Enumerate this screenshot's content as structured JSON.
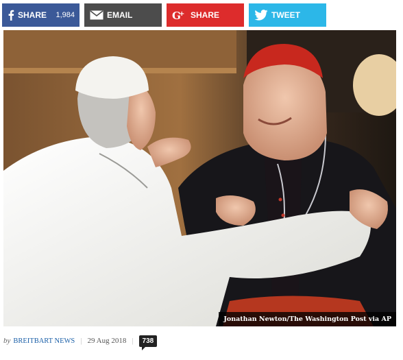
{
  "share": {
    "facebook": {
      "label": "SHARE",
      "count": "1,984",
      "icon": "facebook-icon",
      "color": "#3b5998"
    },
    "email": {
      "label": "EMAIL",
      "icon": "envelope-icon",
      "color": "#4c4c4c"
    },
    "gplus": {
      "label": "SHARE",
      "icon": "google-plus-icon",
      "color": "#dd2c2c"
    },
    "twitter": {
      "label": "TWEET",
      "icon": "twitter-bird-icon",
      "color": "#2cb7e8"
    }
  },
  "photo": {
    "credit": "Jonathan Newton/The Washington Post via AP"
  },
  "byline": {
    "by": "by",
    "author": "BREITBART NEWS",
    "date": "29 Aug 2018",
    "comments": "738"
  }
}
